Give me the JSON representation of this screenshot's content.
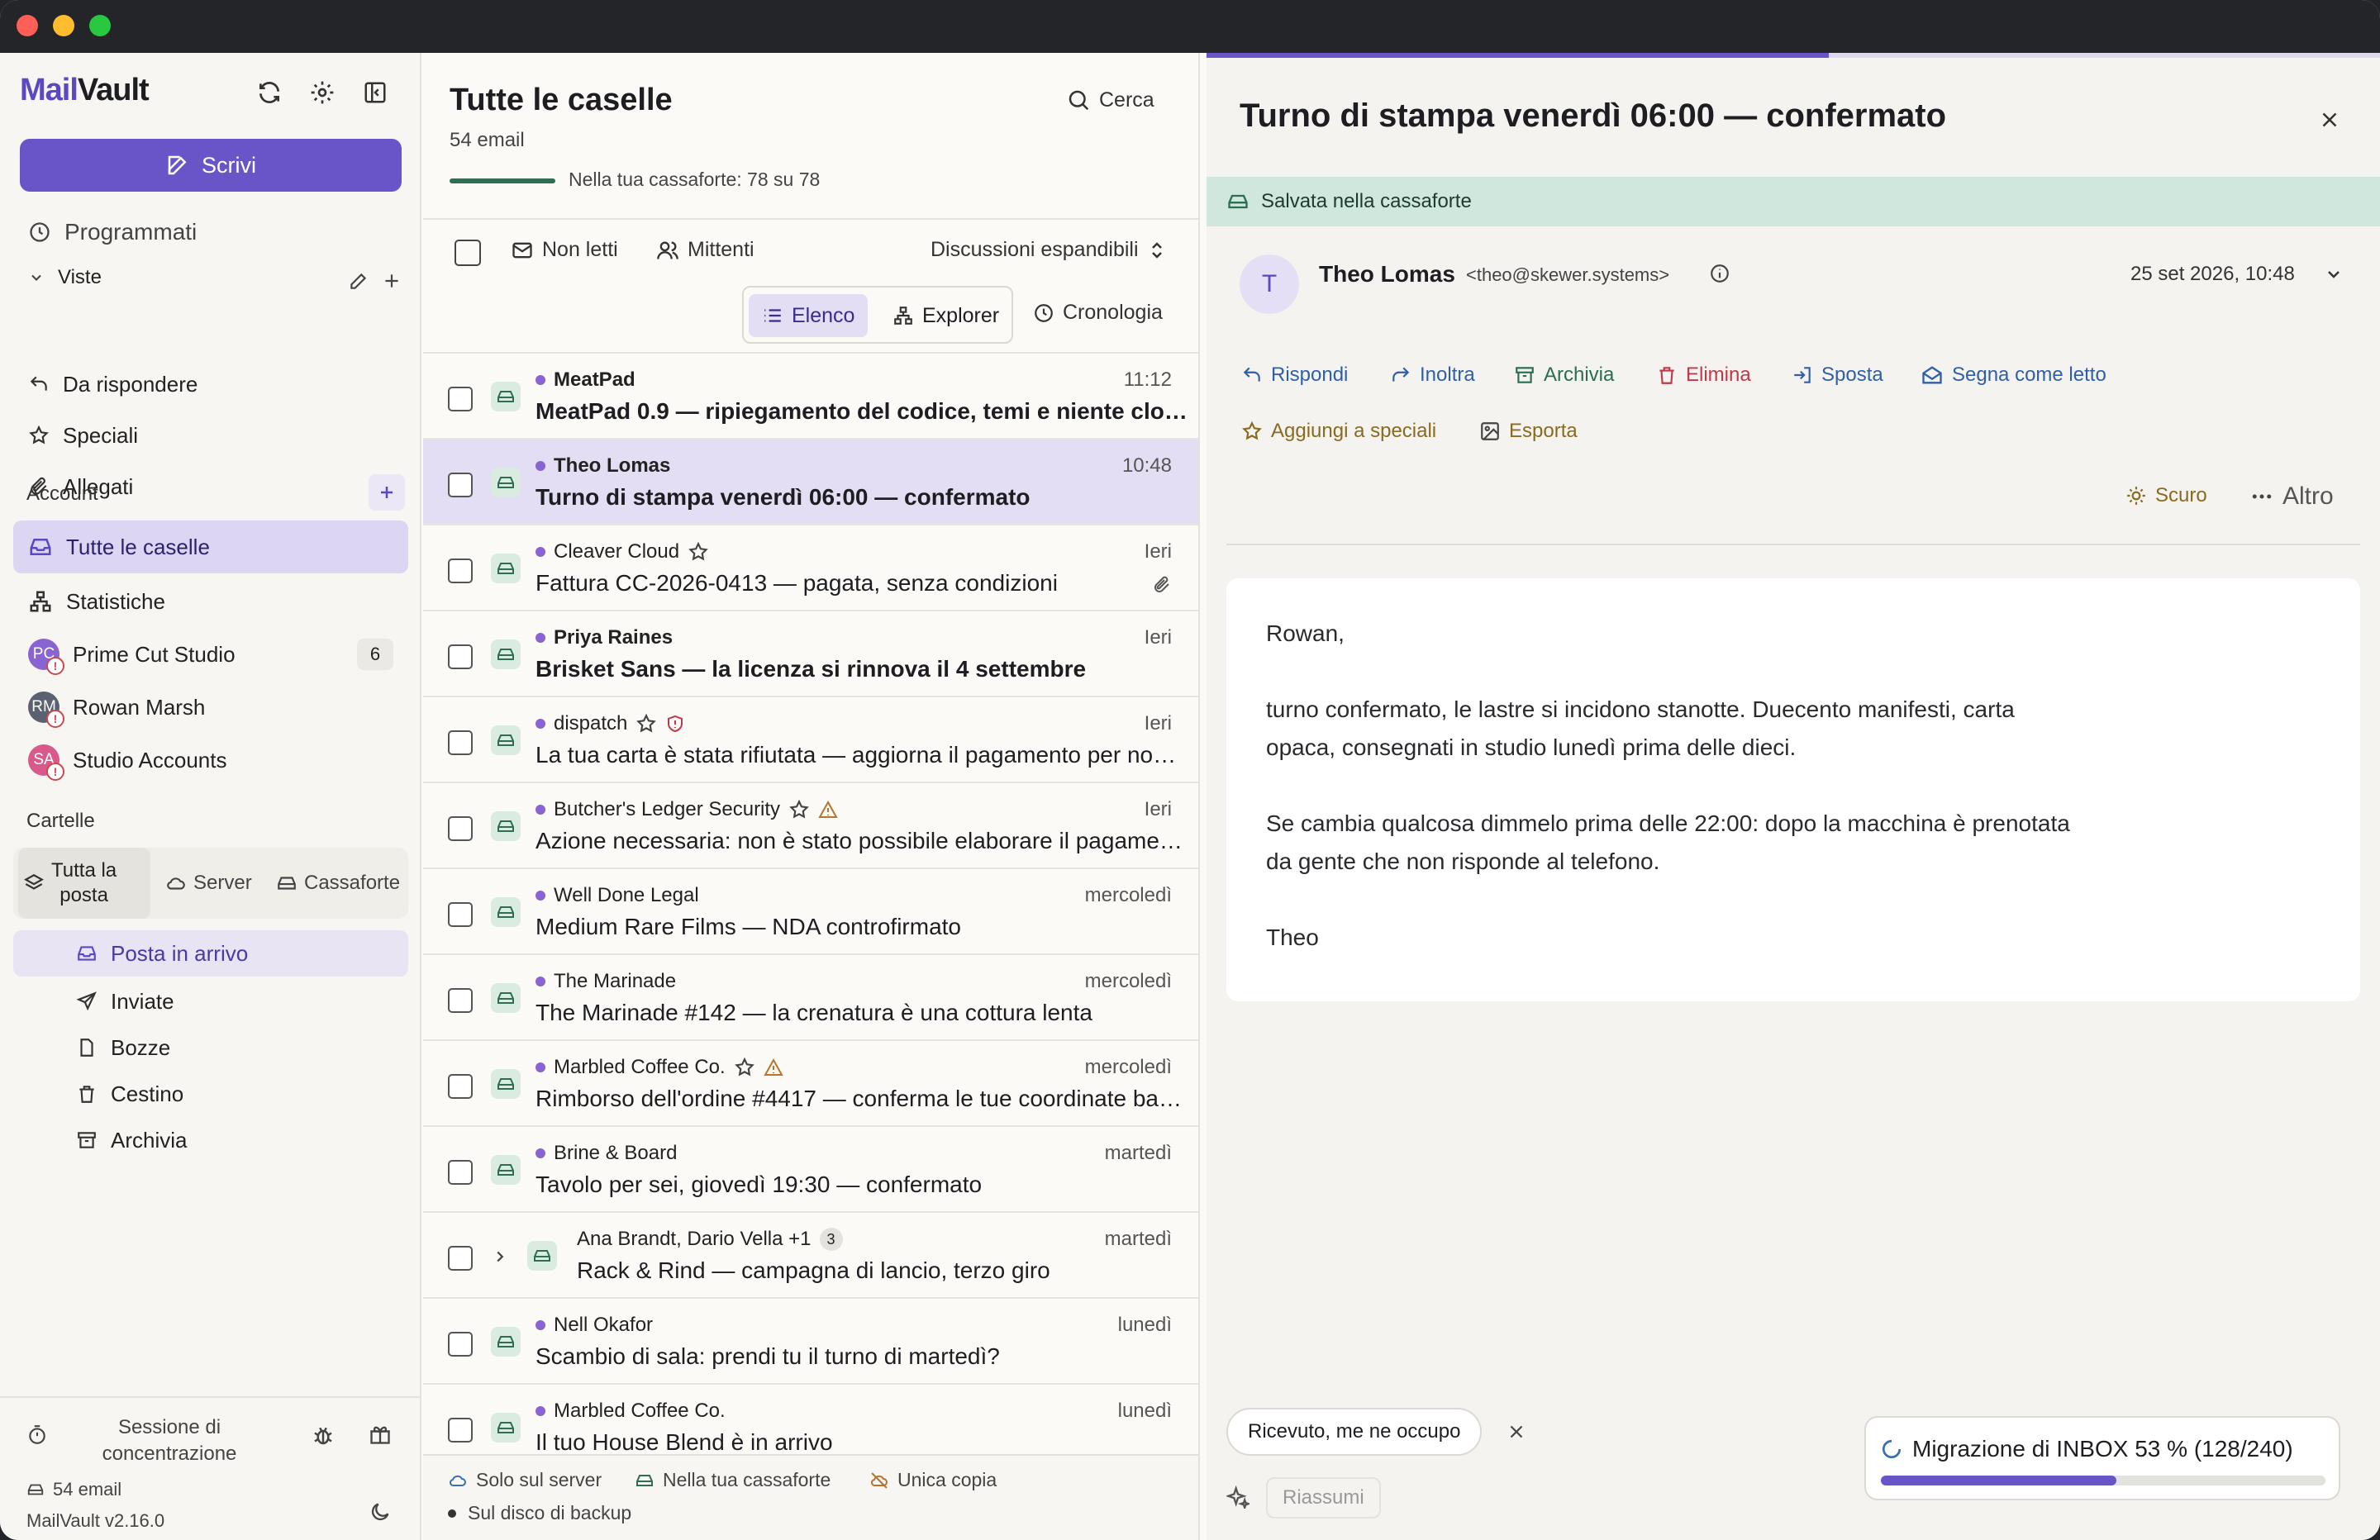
{
  "app": {
    "brand_prefix": "Mail",
    "brand_suffix": "Vault",
    "compose_label": "Scrivi"
  },
  "sidebar": {
    "scheduled": "Programmati",
    "views_label": "Viste",
    "views": [
      "Da rispondere",
      "Speciali",
      "Allegati"
    ],
    "account_label": "Account",
    "accounts": [
      {
        "label": "Tutte le caselle"
      },
      {
        "label": "Statistiche"
      },
      {
        "label": "Prime Cut Studio",
        "initials": "PC",
        "badge": "6",
        "color": "#8a63d2"
      },
      {
        "label": "Rowan Marsh",
        "initials": "RM",
        "color": "#5a6170"
      },
      {
        "label": "Studio Accounts",
        "initials": "SA",
        "color": "#d95a8a"
      }
    ],
    "folders_label": "Cartelle",
    "folder_filter": [
      "Tutta la",
      "posta",
      "Server",
      "Cassaforte"
    ],
    "folders": [
      "Posta in arrivo",
      "Inviate",
      "Bozze",
      "Cestino",
      "Archivia"
    ],
    "footer": {
      "focus_session_1": "Sessione di",
      "focus_session_2": "concentrazione",
      "email_count": "54 email",
      "version": "MailVault v2.16.0"
    }
  },
  "list": {
    "title": "Tutte le caselle",
    "count": "54 email",
    "search": "Cerca",
    "vault_progress_text": "Nella tua cassaforte: 78 su 78",
    "vault_progress": 1.0,
    "filters": {
      "unread": "Non letti",
      "senders": "Mittenti",
      "threads": "Discussioni espandibili"
    },
    "views": {
      "list": "Elenco",
      "explorer": "Explorer",
      "timeline": "Cronologia"
    },
    "rows": [
      {
        "sender": "MeatPad",
        "subject": "MeatPad 0.9 — ripiegamento del codice, temi e niente cloud",
        "date": "11:12",
        "unread": true
      },
      {
        "sender": "Theo Lomas",
        "subject": "Turno di stampa venerdì 06:00 — confermato",
        "date": "10:48",
        "unread": true,
        "selected": true
      },
      {
        "sender": "Cleaver Cloud",
        "subject": "Fattura CC-2026-0413 — pagata, senza condizioni",
        "date": "Ieri",
        "star": true,
        "attach": true
      },
      {
        "sender": "Priya Raines",
        "subject": "Brisket Sans — la licenza si rinnova il 4 settembre",
        "date": "Ieri",
        "unread": true
      },
      {
        "sender": "dispatch",
        "subject": "La tua carta è stata rifiutata — aggiorna il pagamento per non perdere l'accesso",
        "date": "Ieri",
        "star": true,
        "shield": true
      },
      {
        "sender": "Butcher's Ledger Security",
        "subject": "Azione necessaria: non è stato possibile elaborare il pagamento",
        "date": "Ieri",
        "star": true,
        "warn": true
      },
      {
        "sender": "Well Done Legal",
        "subject": "Medium Rare Films — NDA controfirmato",
        "date": "mercoledì"
      },
      {
        "sender": "The Marinade",
        "subject": "The Marinade #142 — la crenatura è una cottura lenta",
        "date": "mercoledì"
      },
      {
        "sender": "Marbled Coffee Co.",
        "subject": "Rimborso dell'ordine #4417 — conferma le tue coordinate bancarie",
        "date": "mercoledì",
        "star": true,
        "warn": true
      },
      {
        "sender": "Brine & Board",
        "subject": "Tavolo per sei, giovedì 19:30 — confermato",
        "date": "martedì"
      },
      {
        "sender": "Ana Brandt, Dario Vella +1",
        "subject": "Rack & Rind — campagna di lancio, terzo giro",
        "date": "martedì",
        "thread": "3"
      },
      {
        "sender": "Nell Okafor",
        "subject": "Scambio di sala: prendi tu il turno di martedì?",
        "date": "lunedì"
      },
      {
        "sender": "Marbled Coffee Co.",
        "subject": "Il tuo House Blend è in arrivo",
        "date": "lunedì"
      }
    ],
    "legend": {
      "server": "Solo sul server",
      "vault": "Nella tua cassaforte",
      "single": "Unica copia",
      "backup": "Sul disco di backup"
    }
  },
  "reader": {
    "title": "Turno di stampa venerdì 06:00 — confermato",
    "saved": "Salvata nella cassaforte",
    "from_initial": "T",
    "from_name": "Theo Lomas",
    "from_email": "<theo@skewer.systems>",
    "date": "25 set 2026, 10:48",
    "actions": {
      "reply": "Rispondi",
      "forward": "Inoltra",
      "archive": "Archivia",
      "delete": "Elimina",
      "move": "Sposta",
      "mark_read": "Segna come letto",
      "star": "Aggiungi a speciali",
      "export": "Esporta",
      "dark": "Scuro",
      "more": "Altro"
    },
    "body": [
      "Rowan,",
      "turno confermato, le lastre si incidono stanotte. Duecento manifesti, carta",
      "opaca, consegnati in studio lunedì prima delle dieci.",
      "Se cambia qualcosa dimmelo prima delle 22:00: dopo la macchina è prenotata",
      "da gente che non risponde al telefono.",
      "Theo"
    ],
    "quick_reply": "Ricevuto, me ne occupo",
    "summarize": "Riassumi",
    "migration": {
      "text": "Migrazione di INBOX 53 % (128/240)",
      "progress": 0.53
    },
    "top_progress": 0.53
  },
  "colors": {
    "accent": "#6a55c8",
    "vault_green": "#cfe7dd",
    "delete_red": "#c0394a",
    "link_blue": "#2f5fa8",
    "star_gold": "#8a6a1e"
  }
}
